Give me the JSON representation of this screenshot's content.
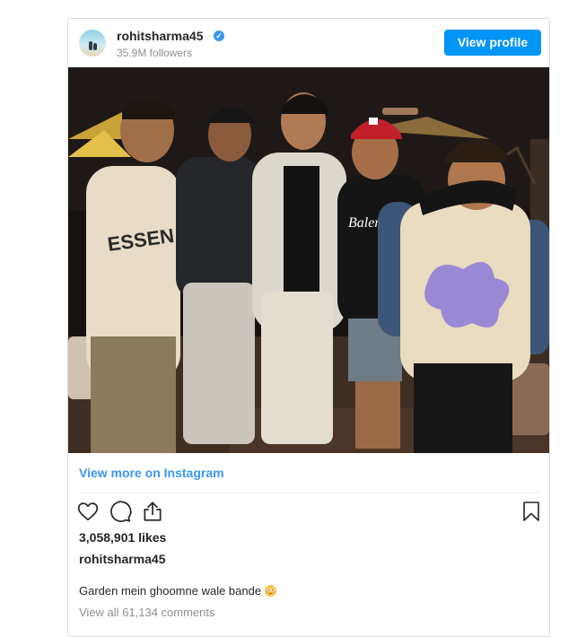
{
  "post": {
    "username": "rohitsharma45",
    "verified_icon": "verified-badge-icon",
    "followers": "35.9M followers",
    "view_profile_label": "View profile",
    "view_more_label": "View more on Instagram",
    "likes": "3,058,901 likes",
    "caption_username": "rohitsharma45",
    "caption": "Garden mein ghoomne wale bande",
    "caption_emoji": "flushed-face-emoji",
    "comments_link": "View all 61,134 comments",
    "actions": [
      "heart-icon",
      "comment-icon",
      "share-icon",
      "bookmark-icon"
    ],
    "colors": {
      "accent": "#0095f6",
      "link": "#3897f0",
      "muted": "#8e8e8e"
    }
  },
  "photo": {
    "hoodie_text_left": "ESSEN",
    "hoodie_text_center": "Balenci"
  }
}
